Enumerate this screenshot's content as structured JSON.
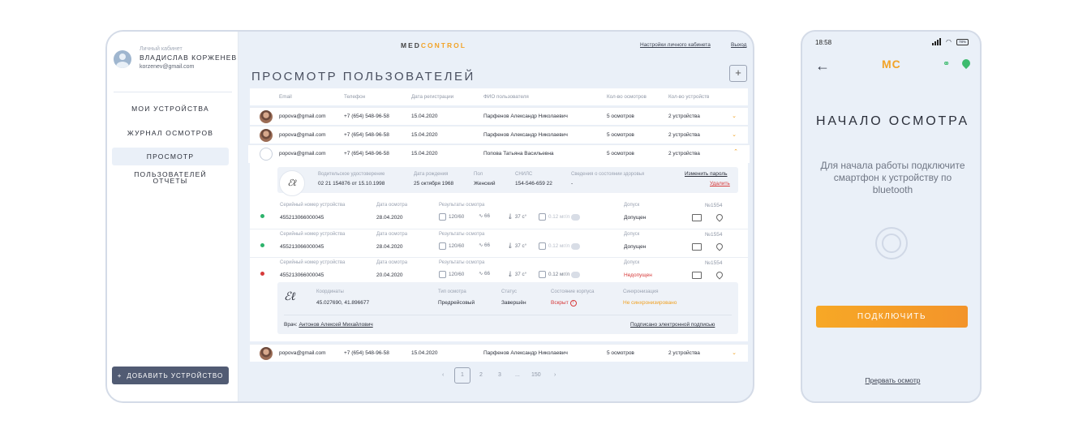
{
  "sidebar": {
    "cabinet_label": "Личный кабинет",
    "user_name": "ВЛАДИСЛАВ КОРЖЕНЕВ",
    "user_email": "korzenev@gmail.com",
    "menu": [
      {
        "label": "МОИ УСТРОЙСТВА",
        "active": false
      },
      {
        "label": "ЖУРНАЛ ОСМОТРОВ",
        "active": false
      },
      {
        "label": "ПРОСМОТР ПОЛЬЗОВАТЕЛЕЙ",
        "active": true
      },
      {
        "label": "ОТЧЕТЫ",
        "active": false
      }
    ],
    "add_button": "ДОБАВИТЬ УСТРОЙСТВО"
  },
  "header": {
    "logo_part1": "MED",
    "logo_part2": "CONTROL",
    "settings_link": "Настройки личного кабинета",
    "logout_link": "Выход",
    "page_title": "ПРОСМОТР ПОЛЬЗОВАТЕЛЕЙ",
    "plus_symbol": "+"
  },
  "table": {
    "columns": [
      "Email",
      "Телефон",
      "Дата регистрации",
      "ФИО пользователя",
      "Кол-во осмотров",
      "Кол-во устройств"
    ],
    "rows": [
      {
        "email": "popova@gmail.com",
        "phone": "+7 (654) 548-96-58",
        "date": "15.04.2020",
        "name": "Парфенов Александр Николаевич",
        "exams": "5 осмотров",
        "devices": "2 устройства"
      },
      {
        "email": "popova@gmail.com",
        "phone": "+7 (654) 548-96-58",
        "date": "15.04.2020",
        "name": "Парфенов Александр Николаевич",
        "exams": "5 осмотров",
        "devices": "2 устройства"
      },
      {
        "email": "popova@gmail.com",
        "phone": "+7 (654) 548-96-58",
        "date": "15.04.2020",
        "name": "Попова Татьяна Васильевна",
        "exams": "5 осмотров",
        "devices": "2 устройства"
      },
      {
        "email": "popova@gmail.com",
        "phone": "+7 (654) 548-96-58",
        "date": "15.04.2020",
        "name": "Парфенов Александр Николаевич",
        "exams": "5 осмотров",
        "devices": "2 устройства"
      }
    ]
  },
  "details": {
    "license_label": "Водительское удостоверение",
    "license_value": "02 21  154876  от 15.10.1998",
    "birth_label": "Дата рождения",
    "birth_value": "25 октября 1968",
    "gender_label": "Пол",
    "gender_value": "Женский",
    "snils_label": "СНИЛС",
    "snils_value": "154-546-659 22",
    "health_label": "Сведения о состоянии здоровья",
    "health_value": "-",
    "change_password": "Изменить пароль",
    "delete": "Удалить"
  },
  "exams": [
    {
      "serial_label": "Серийный номер устройства",
      "serial": "455213066000045",
      "date_label": "Дата осмотра",
      "date": "28.04.2020",
      "results_label": "Результаты осмотра",
      "pressure": "120/60",
      "pulse": "66",
      "temp": "37 с°",
      "alcohol": "0.12 мг/л",
      "admit_label": "Допуск",
      "admit": "Допущен",
      "number": "№1554",
      "ok": true
    },
    {
      "serial_label": "Серийный номер устройства",
      "serial": "455213066000045",
      "date_label": "Дата осмотра",
      "date": "28.04.2020",
      "results_label": "Результаты осмотра",
      "pressure": "120/60",
      "pulse": "66",
      "temp": "37 с°",
      "alcohol": "0.12 мг/л",
      "admit_label": "Допуск",
      "admit": "Допущен",
      "number": "№1554",
      "ok": true
    },
    {
      "serial_label": "Серийный номер устройства",
      "serial": "455213066000045",
      "date_label": "Дата осмотра",
      "date": "20.04.2020",
      "results_label": "Результаты осмотра",
      "pressure": "120/60",
      "pulse": "66",
      "temp": "37 с°",
      "alcohol": "0.12 мг/л",
      "admit_label": "Допуск",
      "admit": "Недопущен",
      "number": "№1554",
      "ok": false
    }
  ],
  "exam_detail": {
    "coords_label": "Координаты",
    "coords": "45.027690, 41.896677",
    "type_label": "Тип осмотра",
    "type": "Предрейсовый",
    "status_label": "Статус",
    "status": "Завершён",
    "case_label": "Состояние корпуса",
    "case": "Вскрыт",
    "sync_label": "Синхронизация",
    "sync": "Не синхронизировано",
    "doctor_prefix": "Врач:",
    "doctor": "Антонов Алексей Михайлович",
    "signed": "Подписано электронной подписью"
  },
  "pagination": {
    "prev": "‹",
    "pages": [
      "1",
      "2",
      "3",
      "...",
      "150"
    ],
    "next": "›",
    "current": "1"
  },
  "phone": {
    "time": "18:58",
    "battery": "78%",
    "logo_m": "M",
    "logo_c": "C",
    "title": "НАЧАЛО ОСМОТРА",
    "text": "Для начала работы подключите смартфон к устройству по bluetooth",
    "connect": "ПОДКЛЮЧИТЬ",
    "abort": "Прервать осмотр"
  },
  "colors": {
    "accent": "#f2a328",
    "sidebar_button": "#515b73",
    "ok_dot": "#2db36b",
    "bad_dot": "#d63a3a",
    "link_green": "#3dbb6e"
  }
}
